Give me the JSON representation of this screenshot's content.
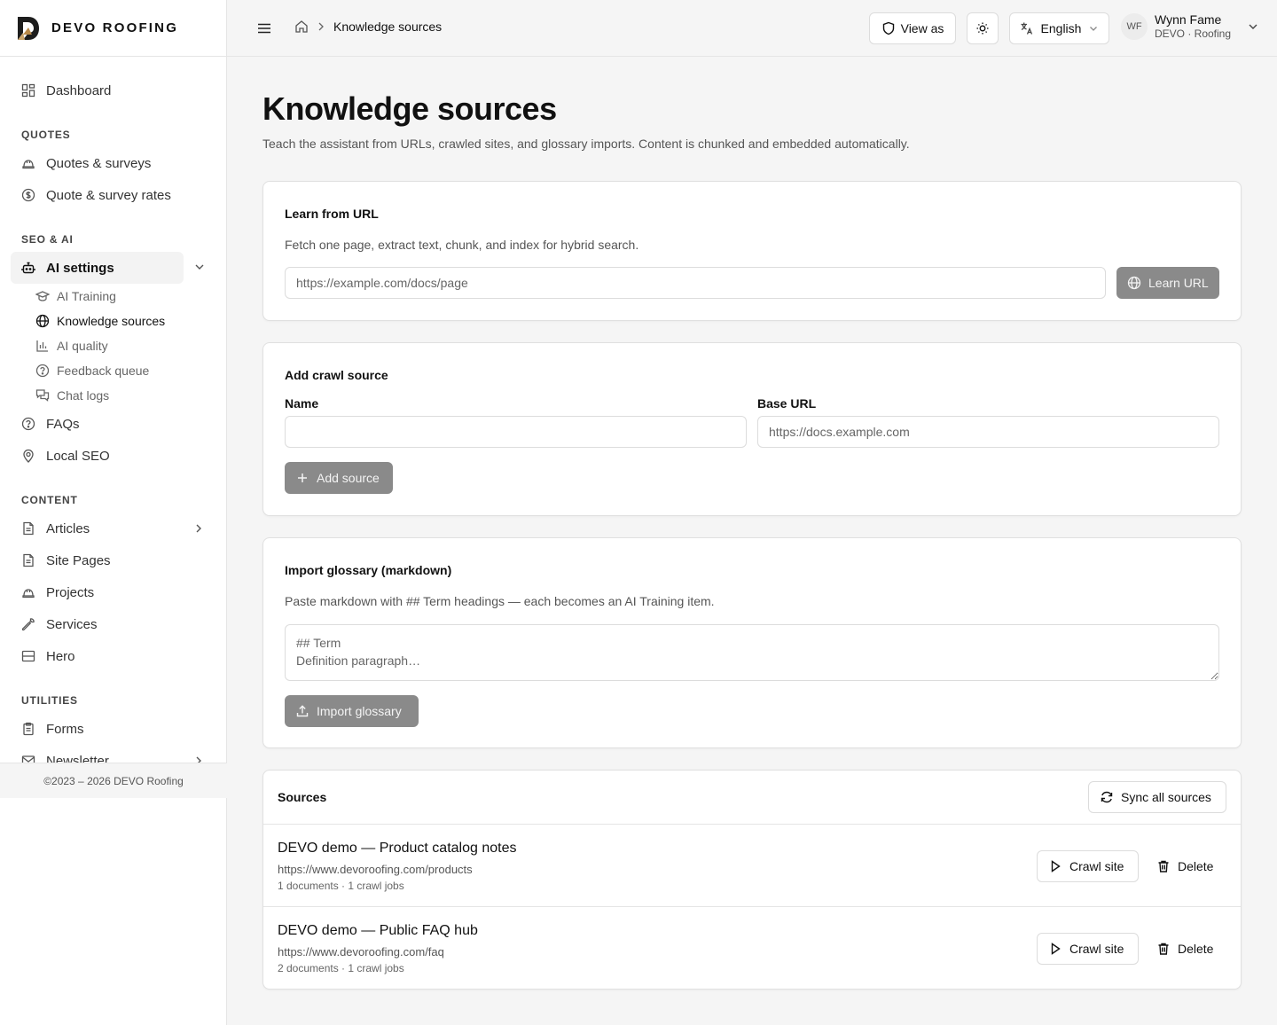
{
  "brand": {
    "name": "DEVO ROOFING"
  },
  "sidebar": {
    "dashboard": "Dashboard",
    "sections": {
      "quotes": "QUOTES",
      "seo_ai": "SEO & AI",
      "content": "CONTENT",
      "utilities": "UTILITIES"
    },
    "quotes_surveys": "Quotes & surveys",
    "quote_rates": "Quote & survey rates",
    "ai_settings": "AI settings",
    "ai_sub": {
      "training": "AI Training",
      "knowledge": "Knowledge sources",
      "quality": "AI quality",
      "feedback": "Feedback queue",
      "chat_logs": "Chat logs"
    },
    "faqs": "FAQs",
    "local_seo": "Local SEO",
    "articles": "Articles",
    "site_pages": "Site Pages",
    "projects": "Projects",
    "services": "Services",
    "hero": "Hero",
    "forms": "Forms",
    "newsletter": "Newsletter",
    "footer": "©2023 – 2026 DEVO Roofing"
  },
  "header": {
    "breadcrumb_current": "Knowledge sources",
    "view_as": "View as",
    "language": "English",
    "user": {
      "initials": "WF",
      "name": "Wynn Fame",
      "org": "DEVO · Roofing"
    }
  },
  "page": {
    "title": "Knowledge sources",
    "subtitle": "Teach the assistant from URLs, crawled sites, and glossary imports. Content is chunked and embedded automatically."
  },
  "learn_url": {
    "title": "Learn from URL",
    "description": "Fetch one page, extract text, chunk, and index for hybrid search.",
    "placeholder": "https://example.com/docs/page",
    "button": "Learn URL"
  },
  "crawl": {
    "title": "Add crawl source",
    "name_label": "Name",
    "name_value": "",
    "base_url_label": "Base URL",
    "base_url_placeholder": "https://docs.example.com",
    "button": "Add source"
  },
  "glossary": {
    "title": "Import glossary (markdown)",
    "description": "Paste markdown with ## Term headings — each becomes an AI Training item.",
    "placeholder": "## Term\nDefinition paragraph…",
    "button": "Import glossary"
  },
  "sources": {
    "title": "Sources",
    "sync_button": "Sync all sources",
    "crawl_label": "Crawl site",
    "delete_label": "Delete",
    "items": [
      {
        "name": "DEVO demo — Product catalog notes",
        "url": "https://www.devoroofing.com/products",
        "meta": "1 documents · 1 crawl jobs"
      },
      {
        "name": "DEVO demo — Public FAQ hub",
        "url": "https://www.devoroofing.com/faq",
        "meta": "2 documents · 1 crawl jobs"
      }
    ]
  }
}
